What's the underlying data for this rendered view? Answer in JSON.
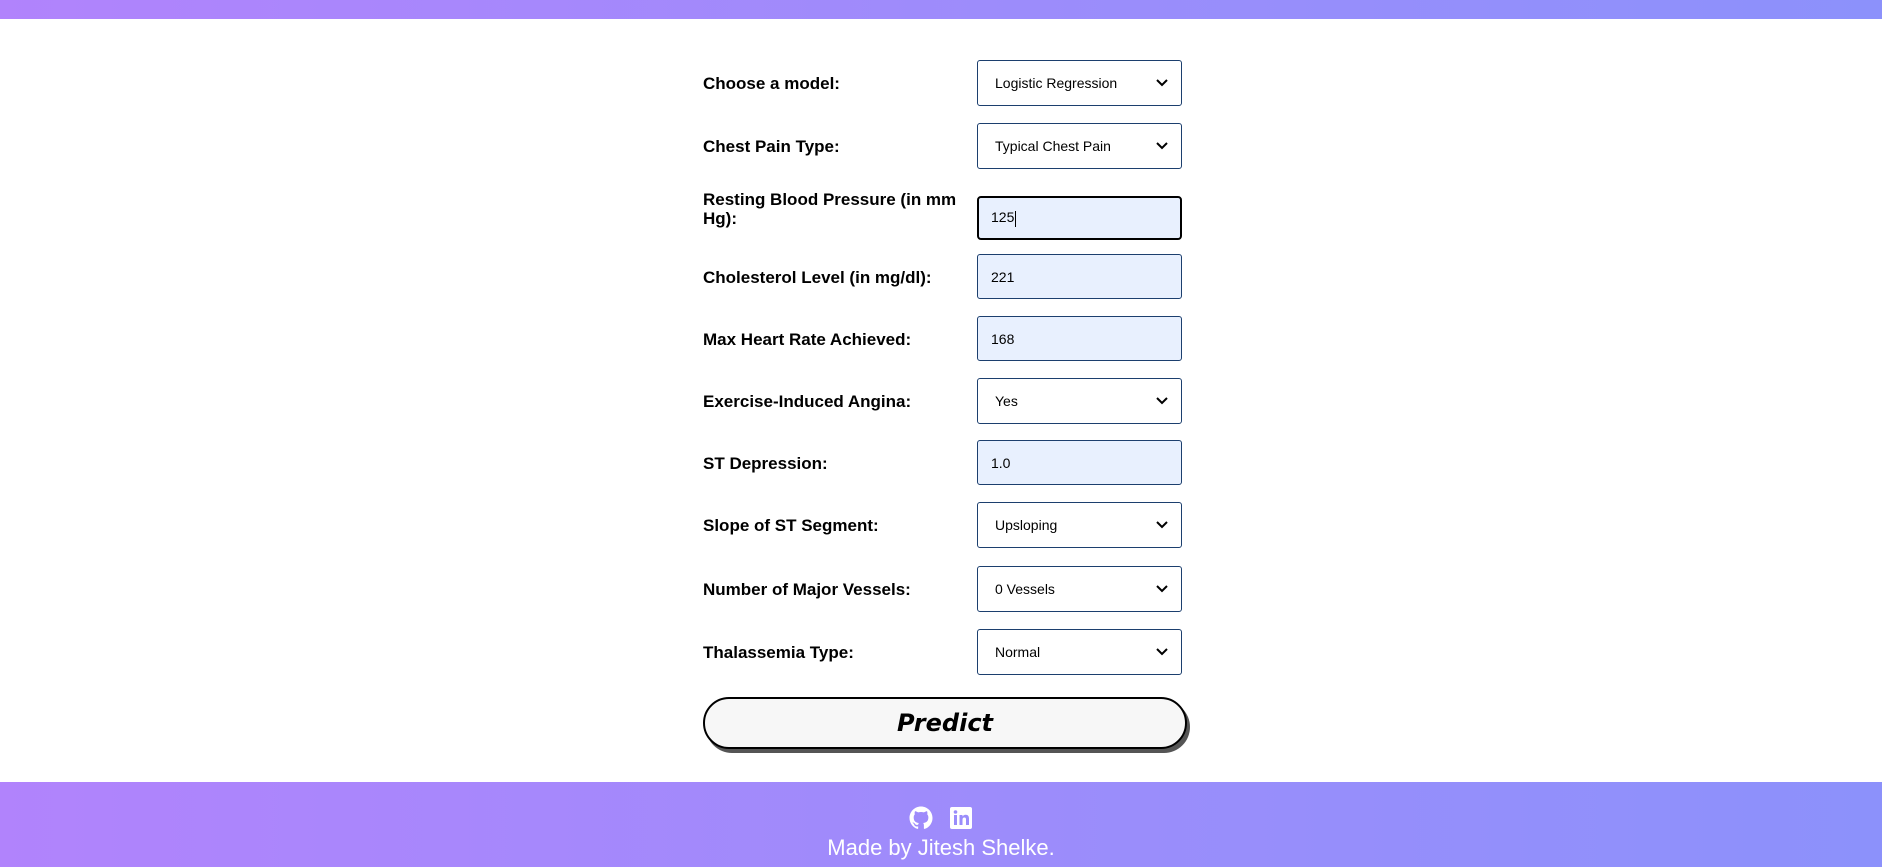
{
  "form": {
    "fields": [
      {
        "label": "Choose a model:",
        "type": "select",
        "value": "Logistic Regression"
      },
      {
        "label": "Chest Pain Type:",
        "type": "select",
        "value": "Typical Chest Pain"
      },
      {
        "label": "Resting Blood Pressure (in mm Hg):",
        "type": "input",
        "value": "125",
        "focused": true
      },
      {
        "label": "Cholesterol Level (in mg/dl):",
        "type": "input",
        "value": "221"
      },
      {
        "label": "Max Heart Rate Achieved:",
        "type": "input",
        "value": "168"
      },
      {
        "label": "Exercise-Induced Angina:",
        "type": "select",
        "value": "Yes"
      },
      {
        "label": "ST Depression:",
        "type": "input",
        "value": "1.0"
      },
      {
        "label": "Slope of ST Segment:",
        "type": "select",
        "value": "Upsloping"
      },
      {
        "label": "Number of Major Vessels:",
        "type": "select",
        "value": "0 Vessels"
      },
      {
        "label": "Thalassemia Type:",
        "type": "select",
        "value": "Normal"
      }
    ],
    "submit_label": "Predict"
  },
  "footer": {
    "icons": [
      "github-icon",
      "linkedin-icon"
    ],
    "credit": "Made by Jitesh Shelke."
  },
  "colors": {
    "gradient_start": "#b183fc",
    "gradient_end": "#8c91fb",
    "input_fill": "#e8f0fe",
    "control_border": "#1c3f6e"
  }
}
